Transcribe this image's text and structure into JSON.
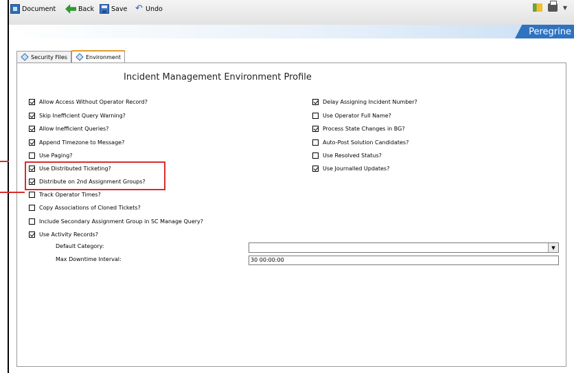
{
  "toolbar": {
    "document_label": "Document",
    "back_label": "Back",
    "save_label": "Save",
    "undo_label": "Undo"
  },
  "banner": {
    "logo_text": "Peregrine"
  },
  "tabs": [
    {
      "label": "Security Files",
      "active": false
    },
    {
      "label": "Environment",
      "active": true
    }
  ],
  "form": {
    "title": "Incident Management Environment Profile",
    "left_options": [
      {
        "label": "Allow Access Without Operator Record?",
        "checked": true
      },
      {
        "label": "Skip Inefficient Query Warning?",
        "checked": true
      },
      {
        "label": "Allow Inefficient Queries?",
        "checked": true
      },
      {
        "label": "Append Timezone to Message?",
        "checked": true
      },
      {
        "label": "Use Paging?",
        "checked": false
      },
      {
        "label": "Use Distributed Ticketing?",
        "checked": true
      },
      {
        "label": "Distribute on 2nd Assignment Groups?",
        "checked": true
      },
      {
        "label": "Track Operator Times?",
        "checked": false
      },
      {
        "label": "Copy Associations of Cloned Tickets?",
        "checked": false
      },
      {
        "label": "Include Secondary Assignment Group in SC Manage Query?",
        "checked": false
      },
      {
        "label": "Use Activity Records?",
        "checked": true
      }
    ],
    "right_options": [
      {
        "label": "Delay Assigning Incident Number?",
        "checked": true
      },
      {
        "label": "Use Operator Full Name?",
        "checked": false
      },
      {
        "label": "Process State Changes in BG?",
        "checked": true
      },
      {
        "label": "Auto-Post Solution Candidates?",
        "checked": false
      },
      {
        "label": "Use Resolved Status?",
        "checked": false
      },
      {
        "label": "Use Journalled Updates?",
        "checked": true
      }
    ],
    "default_category_label": "Default Category:",
    "default_category_value": "",
    "max_downtime_label": "Max Downtime Interval:",
    "max_downtime_value": "30 00:00:00"
  },
  "colors": {
    "highlight": "#d82a2a",
    "brand": "#2f73c0",
    "active_tab": "#e79a2a"
  }
}
